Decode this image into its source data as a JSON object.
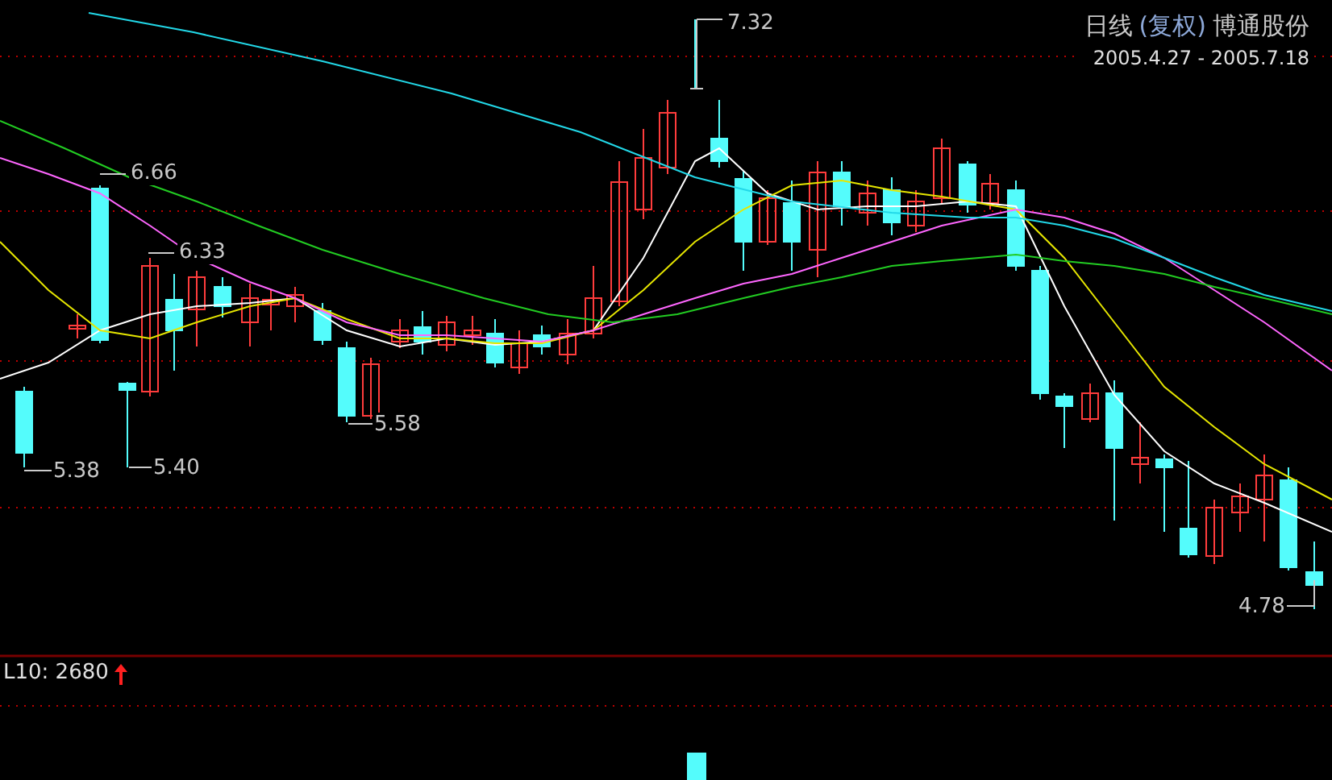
{
  "header": {
    "period": "日线",
    "adjust": "(复权)",
    "stock": "博通股份",
    "date_range": "2005.4.27 - 2005.7.18"
  },
  "price_labels": [
    {
      "text": "7.32"
    },
    {
      "text": "6.66"
    },
    {
      "text": "6.33"
    },
    {
      "text": "5.58"
    },
    {
      "text": "5.38"
    },
    {
      "text": "5.40"
    },
    {
      "text": "4.78"
    }
  ],
  "volume": {
    "indicator": "L10: 2680"
  }
}
